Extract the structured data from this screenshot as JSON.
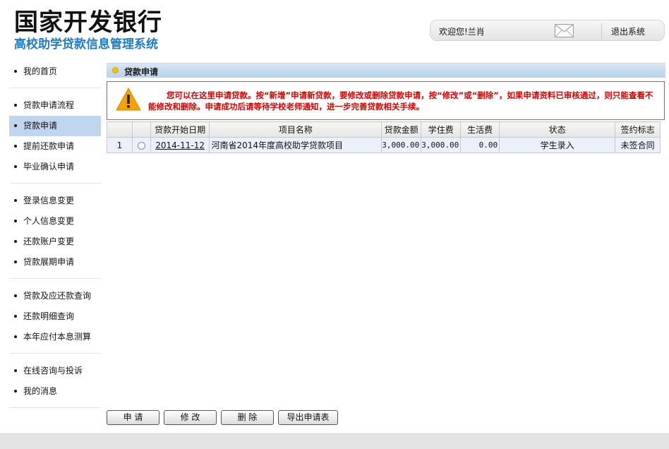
{
  "header": {
    "title": "国家开发银行",
    "subtitle": "高校助学贷款信息管理系统",
    "welcome": "欢迎您!兰肖",
    "logout": "退出系统"
  },
  "sidebar": {
    "groups": [
      [
        "我的首页"
      ],
      [
        "贷款申请流程",
        "贷款申请",
        "提前还款申请",
        "毕业确认申请"
      ],
      [
        "登录信息变更",
        "个人信息变更",
        "还款账户变更",
        "贷款展期申请"
      ],
      [
        "贷款及应还款查询",
        "还款明细查询",
        "本年应付本息测算"
      ],
      [
        "在线咨询与投诉",
        "我的消息"
      ]
    ],
    "active": "贷款申请"
  },
  "section": {
    "title": "贷款申请"
  },
  "notice": {
    "text": "您可以在这里申请贷款。按“新增”申请新贷款，要修改或删除贷款申请，按“修改”或“删除”，如果申请资料已审核通过，则只能查看不能修改和删除。申请成功后请等待学校老师通知，进一步完善贷款相关手续。"
  },
  "table": {
    "headers": [
      "",
      "",
      "贷款开始日期",
      "项目名称",
      "贷款金额",
      "学住费",
      "生活费",
      "状态",
      "签约标志"
    ],
    "rows": [
      {
        "index": "1",
        "date": "2014-11-12",
        "project": "河南省2014年度高校助学贷款项目",
        "amount": "3,000.00",
        "tuition": "3,000.00",
        "living": "0.00",
        "status": "学生录入",
        "sign": "未签合同"
      }
    ]
  },
  "buttons": {
    "apply": "申 请",
    "modify": "修 改",
    "delete": "删 除",
    "export": "导出申请表"
  },
  "colors": {
    "accent": "#1f7cc1",
    "notice_red": "#d40000",
    "active_nav": "#bfd6ee"
  }
}
